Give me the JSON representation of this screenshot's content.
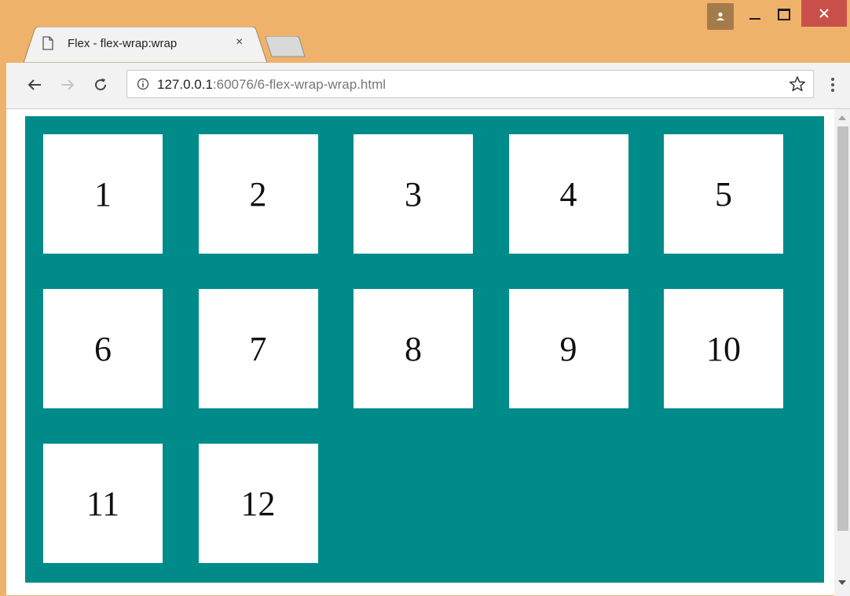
{
  "window": {
    "frame_color": "#efb26a",
    "close_color": "#c9504a"
  },
  "tab": {
    "title": "Flex - flex-wrap:wrap",
    "close_glyph": "×"
  },
  "toolbar": {
    "back_glyph": "←",
    "forward_glyph": "→",
    "reload_glyph": "C",
    "url_host": "127.0.0.1",
    "url_rest": ":60076/6-flex-wrap-wrap.html"
  },
  "page": {
    "container_color": "#008b8b",
    "items": [
      "1",
      "2",
      "3",
      "4",
      "5",
      "6",
      "7",
      "8",
      "9",
      "10",
      "11",
      "12"
    ]
  },
  "icons": {
    "profile": "profile-icon",
    "minimize": "minimize-icon",
    "maximize": "maximize-icon",
    "close": "close-icon",
    "file": "file-icon",
    "info": "info-icon",
    "star": "star-icon",
    "menu": "menu-dots-icon"
  }
}
